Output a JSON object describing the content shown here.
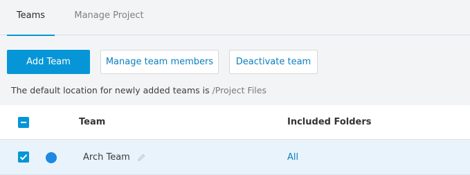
{
  "tabs": [
    {
      "label": "Teams",
      "active": true
    },
    {
      "label": "Manage Project",
      "active": false
    }
  ],
  "toolbar": {
    "add_team_label": "Add Team",
    "manage_members_label": "Manage team members",
    "deactivate_label": "Deactivate team"
  },
  "info": {
    "text": "The default location for newly added teams is ",
    "path": "/Project Files"
  },
  "table": {
    "headers": {
      "team": "Team",
      "folders": "Included Folders"
    },
    "select_all_state": "indeterminate",
    "rows": [
      {
        "selected": true,
        "team_color": "#1e88e5",
        "team": "Arch Team",
        "folders": "All"
      }
    ]
  },
  "colors": {
    "accent": "#0696d7",
    "link": "#0a7fc0",
    "row_selected_bg": "#e8f3fb"
  },
  "icons": [
    "minus-checkbox-icon",
    "checkmark-icon",
    "pencil-icon",
    "team-color-dot"
  ]
}
